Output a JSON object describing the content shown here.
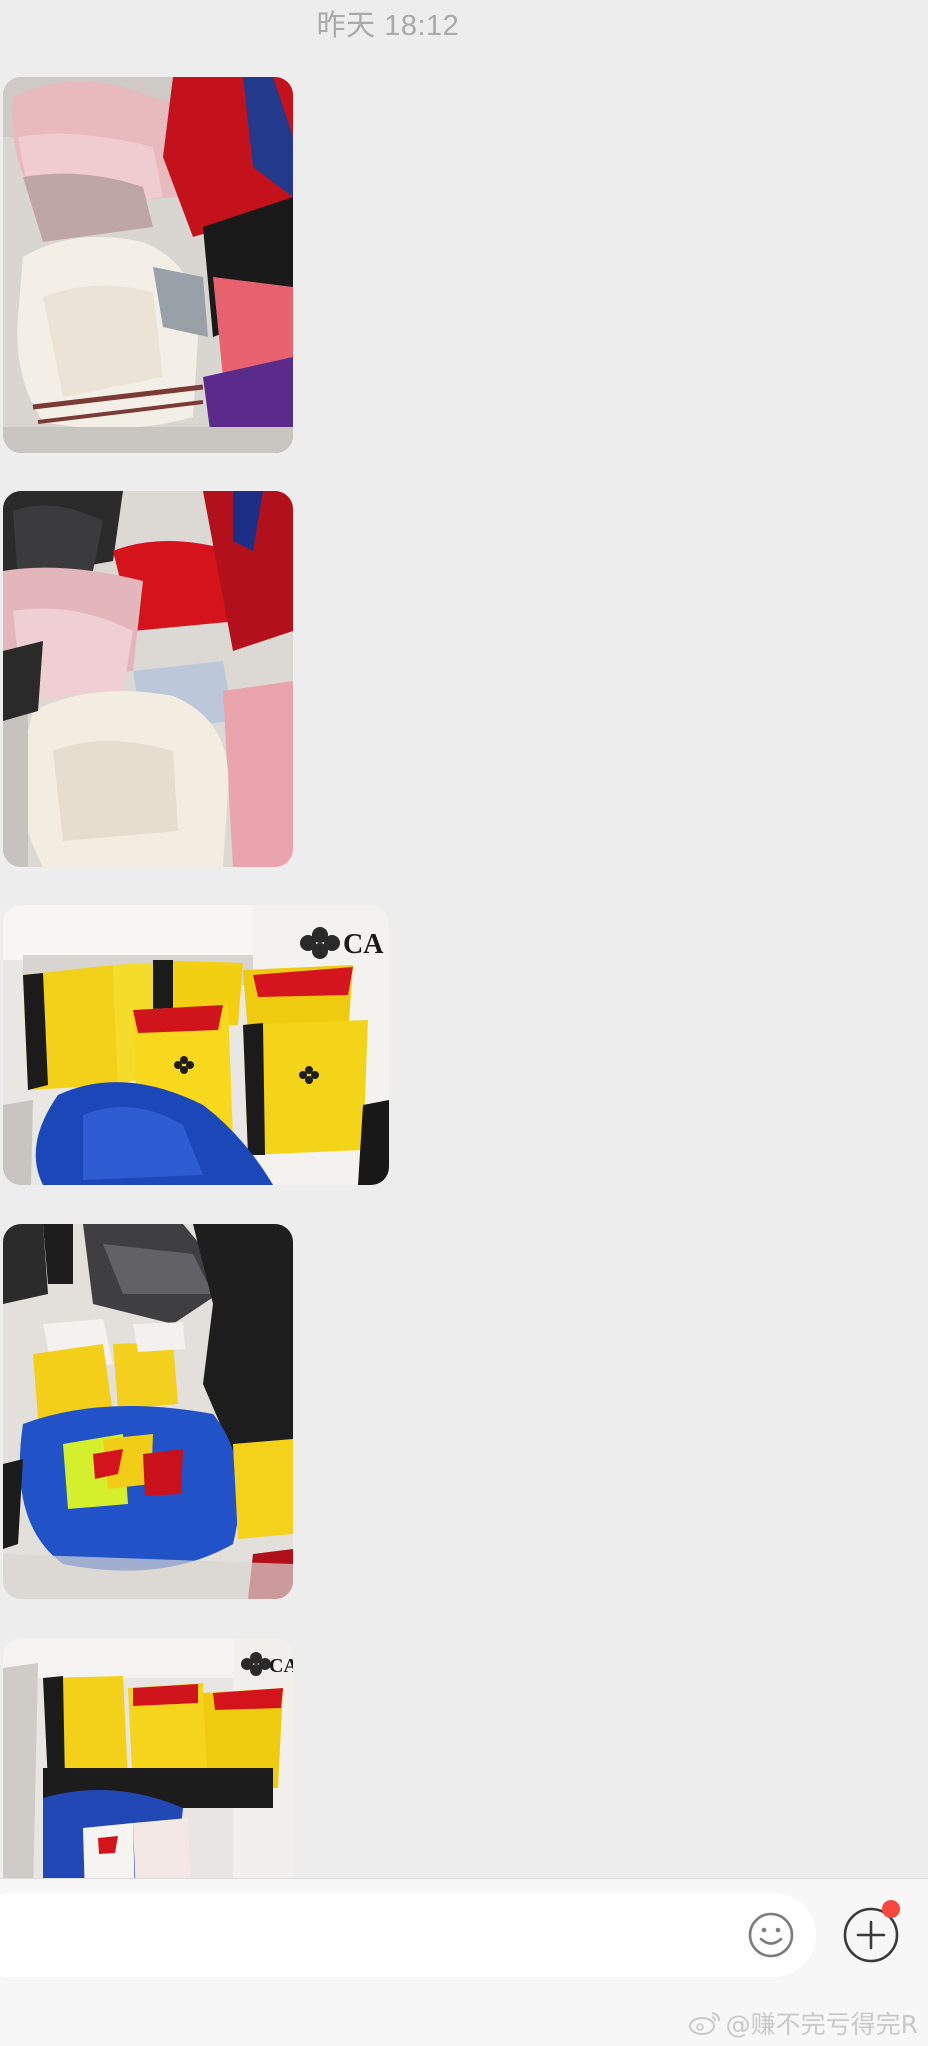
{
  "chat": {
    "timestamp": "昨天 18:12",
    "messages": [
      {
        "type": "image",
        "icon": "photo-clothing-pile"
      },
      {
        "type": "image",
        "icon": "photo-clothing-pile"
      },
      {
        "type": "image",
        "icon": "photo-yellow-shopping-bags"
      },
      {
        "type": "image",
        "icon": "photo-bags-being-packed"
      },
      {
        "type": "image",
        "icon": "photo-yellow-shopping-bags"
      }
    ]
  },
  "input_bar": {
    "text_value": "",
    "emoji_icon": "smiley-icon",
    "more_icon": "plus-circle-icon",
    "has_notification_dot": true
  },
  "watermark": {
    "text": "@赚不完亏得完R",
    "icon": "weibo-icon"
  },
  "colors": {
    "background": "#ededed",
    "input_bar": "#f7f7f7",
    "notification": "#f5473f",
    "timestamp": "#a9a9a9"
  }
}
